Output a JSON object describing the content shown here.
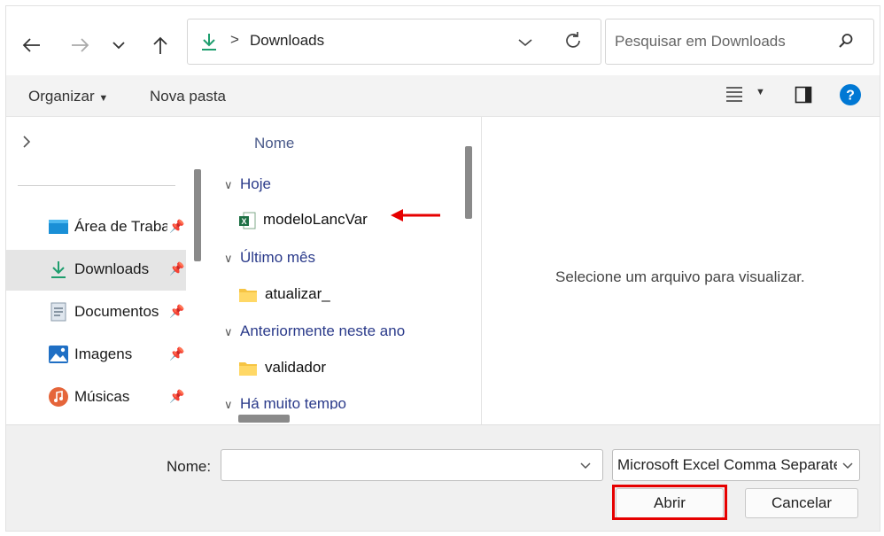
{
  "address": {
    "location": "Downloads",
    "separator": ">"
  },
  "search": {
    "placeholder": "Pesquisar em Downloads"
  },
  "toolbar": {
    "organize": "Organizar",
    "new_folder": "Nova pasta"
  },
  "nav": {
    "items": [
      {
        "label": "Área de Trabalho",
        "icon": "desktop-icon"
      },
      {
        "label": "Downloads",
        "icon": "download-icon",
        "selected": true
      },
      {
        "label": "Documentos",
        "icon": "document-icon"
      },
      {
        "label": "Imagens",
        "icon": "pictures-icon"
      },
      {
        "label": "Músicas",
        "icon": "music-icon"
      }
    ]
  },
  "filelist": {
    "column_header": "Nome",
    "groups": [
      {
        "label": "Hoje",
        "files": [
          {
            "name": "modeloLancVar",
            "icon": "excel-file-icon"
          }
        ]
      },
      {
        "label": "Último mês",
        "files": [
          {
            "name": "atualizar_",
            "icon": "folder-icon"
          }
        ]
      },
      {
        "label": "Anteriormente neste ano",
        "files": [
          {
            "name": "validador",
            "icon": "folder-icon"
          }
        ]
      },
      {
        "label": "Há muito tempo",
        "files": []
      }
    ]
  },
  "preview": {
    "message": "Selecione um arquivo para visualizar."
  },
  "footer": {
    "name_label": "Nome:",
    "name_value": "",
    "file_type": "Microsoft Excel Comma Separated",
    "open_label": "Abrir",
    "cancel_label": "Cancelar"
  },
  "colors": {
    "accent": "#0078d4",
    "highlight": "#e60000",
    "arrow": "#e60000"
  }
}
